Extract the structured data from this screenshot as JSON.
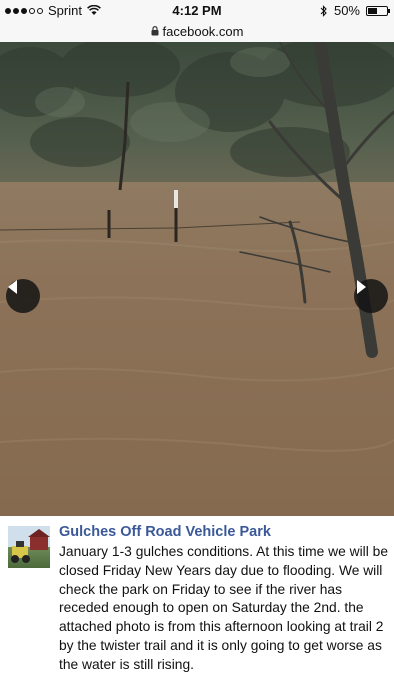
{
  "status_bar": {
    "carrier": "Sprint",
    "time": "4:12 PM",
    "battery": "50%",
    "signal_bars_filled": 3,
    "signal_bars_total": 5,
    "battery_level": 0.5
  },
  "url_bar": {
    "url": "facebook.com",
    "icon": "lock-icon"
  },
  "photo": {
    "nav_prev_icon": "chevron-left-icon",
    "nav_next_icon": "chevron-right-icon"
  },
  "post": {
    "page_name": "Gulches Off Road Vehicle Park",
    "text": "January 1-3 gulches conditions. At this time we will be closed Friday New Years day due to flooding. We will check the park on Friday to see if the river has receded enough to open on Saturday the 2nd. the attached photo is from this afternoon looking at trail 2 by the twister trail and it is only going to get worse as the water is still rising."
  },
  "colors": {
    "link": "#3b5998",
    "water": "#8b7357",
    "trees": "#4b5645"
  }
}
